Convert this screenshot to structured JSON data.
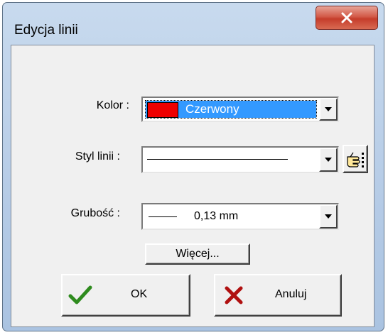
{
  "window": {
    "title": "Edycja linii"
  },
  "fields": {
    "color_label": "Kolor :",
    "color_value": "Czerwony",
    "color_hex": "#ee0000",
    "style_label": "Styl linii :",
    "thickness_label": "Grubość :",
    "thickness_value": "0,13 mm"
  },
  "buttons": {
    "more": "Więcej...",
    "ok": "OK",
    "cancel": "Anuluj"
  },
  "colors": {
    "selection": "#3399ff",
    "close_button": "#c53d2b",
    "ok_check": "#2e8b1e",
    "cancel_x": "#b01010"
  }
}
